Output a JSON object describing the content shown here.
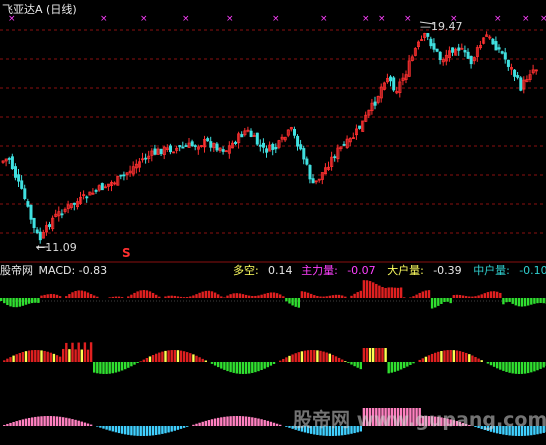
{
  "header": {
    "title": "飞亚达A (日线)"
  },
  "price_panel": {
    "high_label": "19.47",
    "low_label": "11.09",
    "signal_mark": "S",
    "grid_levels": 8
  },
  "indicator": {
    "name": "股帝网",
    "macd_label": "MACD: -0.83",
    "values": [
      {
        "label": "多空:",
        "value": "0.14",
        "label_color": "#ffff60",
        "value_color": "#e8e8e8"
      },
      {
        "label": "主力量:",
        "value": "-0.07",
        "label_color": "#ff40ff",
        "value_color": "#ff40ff"
      },
      {
        "label": "大户量:",
        "value": "-0.39",
        "label_color": "#ffff60",
        "value_color": "#e8e8e8"
      },
      {
        "label": "中户量:",
        "value": "-0.10",
        "label_color": "#30d0d0",
        "value_color": "#30d0d0"
      }
    ],
    "extra_glyph": "♀"
  },
  "watermark": "股帝网 www.gupang.com",
  "colors": {
    "up": "#ff3030",
    "down": "#40e0e0",
    "grid": "#8a1010",
    "bar_red": "#e02020",
    "bar_green": "#30e030",
    "bar_yellow": "#ffff50",
    "bar_cyan": "#40d0ff",
    "bar_pink": "#ff80c0",
    "marker": "#ff40ff"
  }
}
